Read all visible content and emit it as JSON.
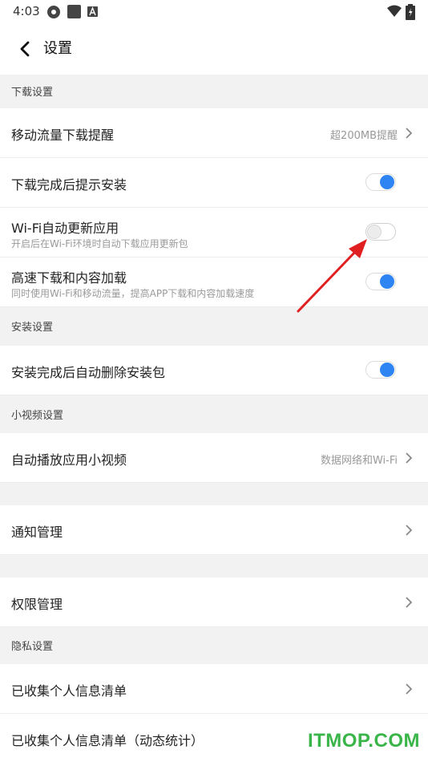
{
  "status_bar": {
    "time": "4:03"
  },
  "header": {
    "title": "设置"
  },
  "sections": {
    "download": {
      "header": "下载设置"
    },
    "install": {
      "header": "安装设置"
    },
    "video": {
      "header": "小视频设置"
    },
    "privacy": {
      "header": "隐私设置"
    }
  },
  "rows": {
    "mobile_data": {
      "title": "移动流量下载提醒",
      "value": "超200MB提醒"
    },
    "install_prompt": {
      "title": "下载完成后提示安装",
      "toggle": true
    },
    "wifi_update": {
      "title": "Wi-Fi自动更新应用",
      "subtitle": "开启后在Wi-Fi环境时自动下载应用更新包",
      "toggle": false
    },
    "high_speed": {
      "title": "高速下载和内容加载",
      "subtitle": "同时使用Wi-Fi和移动流量，提高APP下载和内容加载速度",
      "toggle": true
    },
    "auto_delete": {
      "title": "安装完成后自动删除安装包",
      "toggle": true
    },
    "autoplay": {
      "title": "自动播放应用小视频",
      "value": "数据网络和Wi-Fi"
    },
    "notifications": {
      "title": "通知管理"
    },
    "permissions": {
      "title": "权限管理"
    },
    "collected_info": {
      "title": "已收集个人信息清单"
    },
    "collected_info_dynamic": {
      "title": "已收集个人信息清单（动态统计）"
    }
  },
  "colors": {
    "accent": "#2f84f3",
    "annotation_arrow": "#e02020",
    "watermark": "#39b54a"
  },
  "watermark": {
    "text": "ITMOP.COM"
  }
}
